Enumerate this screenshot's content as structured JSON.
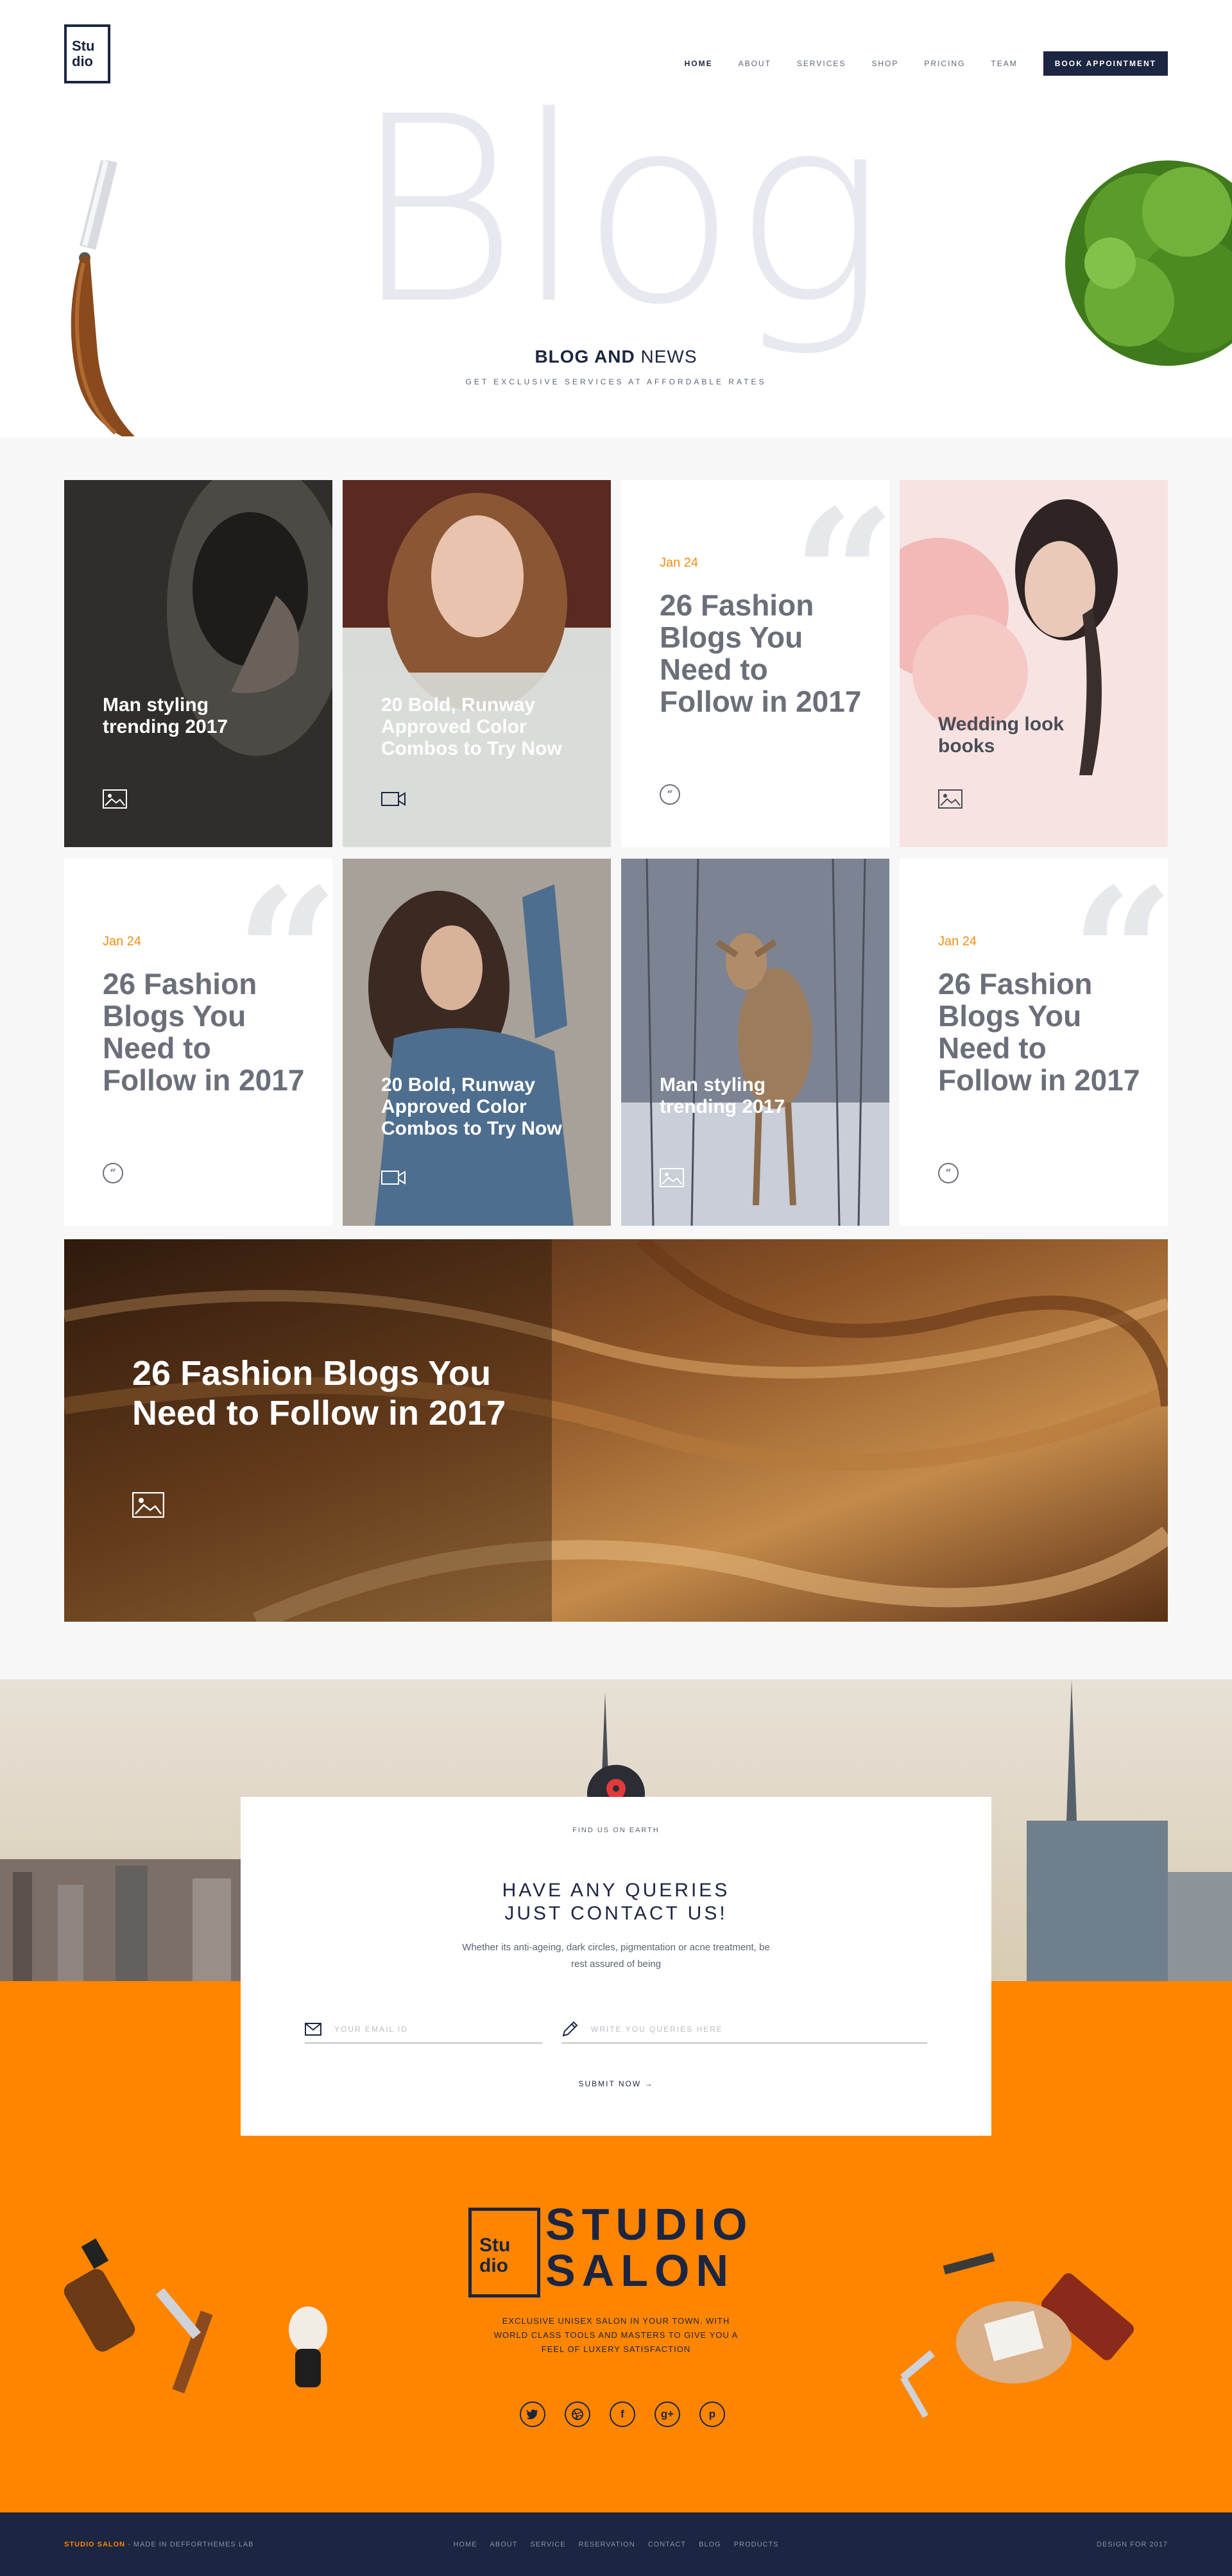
{
  "header": {
    "logo": [
      "Stu",
      "dio"
    ],
    "nav": [
      "HOME",
      "ABOUT",
      "SERVICES",
      "SHOP",
      "PRICING",
      "TEAM"
    ],
    "cta": "BOOK APPOINTMENT"
  },
  "hero": {
    "big_word": "Blog",
    "title_bold": "BLOG AND",
    "title_light": " NEWS",
    "subtitle": "GET EXCLUSIVE SERVICES AT AFFORDABLE RATES"
  },
  "cards": [
    {
      "type": "image",
      "title": "Man styling trending 2017",
      "icon": "image-icon"
    },
    {
      "type": "image",
      "title": "20 Bold, Runway Approved Color Combos to Try Now",
      "icon": "video-icon"
    },
    {
      "type": "quote",
      "date": "Jan 24",
      "title": "26 Fashion Blogs You Need to Follow in 2017",
      "icon": "quote-icon"
    },
    {
      "type": "image",
      "title": "Wedding look books",
      "icon": "image-icon"
    },
    {
      "type": "quote",
      "date": "Jan 24",
      "title": "26 Fashion Blogs You Need to Follow in 2017",
      "icon": "quote-icon"
    },
    {
      "type": "image",
      "title": "20 Bold, Runway Approved Color Combos to Try Now",
      "icon": "video-icon"
    },
    {
      "type": "image",
      "title": "Man styling trending 2017",
      "icon": "image-icon"
    },
    {
      "type": "quote",
      "date": "Jan 24",
      "title": "26 Fashion Blogs You Need to Follow in 2017",
      "icon": "quote-icon"
    }
  ],
  "wide_card": {
    "title": "26 Fashion Blogs You Need to Follow in 2017",
    "icon": "image-icon"
  },
  "contact": {
    "find_us": "FIND US ON EARTH",
    "heading_1": "HAVE ANY QUERIES",
    "heading_2": "JUST CONTACT US!",
    "paragraph": "Whether its anti-ageing, dark circles, pigmentation or acne treatment, be rest assured of being",
    "email_placeholder": "YOUR EMAIL ID",
    "query_placeholder": "WRITE YOU QUERIES HERE",
    "submit": "SUBMIT NOW →"
  },
  "brand": {
    "logo": [
      "Stu",
      "dio"
    ],
    "name_1": "STUDIO",
    "name_2": "SALON",
    "description": "EXCLUSIVE UNISEX SALON IN YOUR TOWN. WITH WORLD CLASS TOOLS AND MASTERS TO GIVE YOU A FEEL OF LUXERY SATISFACTION",
    "socials": [
      "twitter-icon",
      "dribbble-icon",
      "facebook-icon",
      "google-plus-icon",
      "pinterest-icon"
    ]
  },
  "bottom": {
    "brand": "STUDIO SALON",
    "made_in": " - MADE IN DEFFORTHEMES LAB",
    "nav": [
      "HOME",
      "ABOUT",
      "SERVICE",
      "RESERVATION",
      "CONTACT",
      "BLOG",
      "PRODUCTS"
    ],
    "right": "DESIGN FOR 2017"
  },
  "colors": {
    "navy": "#1c2541",
    "orange": "#fe8500",
    "accent_date": "#f28c0f",
    "grid_bg": "#f7f7f8"
  }
}
